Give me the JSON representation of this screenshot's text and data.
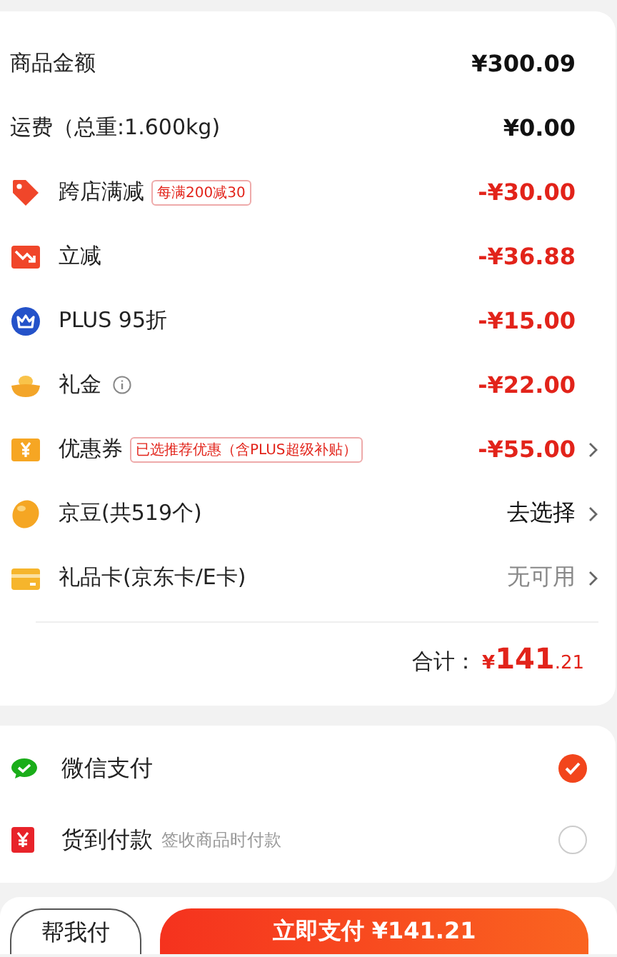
{
  "summary": {
    "rows": [
      {
        "kind": "plain",
        "label": "商品金额",
        "value": "¥300.09",
        "highlighted": false,
        "disabled": false,
        "chevron": false
      },
      {
        "kind": "plain",
        "label": "运费（总重:1.600kg)",
        "value": "¥0.00",
        "highlighted": false,
        "disabled": false,
        "chevron": false
      },
      {
        "kind": "tag",
        "label": "跨店满减",
        "badge": "每满200减30",
        "value": "-¥30.00",
        "highlighted": true,
        "disabled": false,
        "chevron": false
      },
      {
        "kind": "drop",
        "label": "立减",
        "value": "-¥36.88",
        "highlighted": true,
        "disabled": false,
        "chevron": false
      },
      {
        "kind": "crown",
        "label": "PLUS 95折",
        "value": "-¥15.00",
        "highlighted": true,
        "disabled": false,
        "chevron": false
      },
      {
        "kind": "ingot",
        "label": "礼金",
        "info": true,
        "value": "-¥22.00",
        "highlighted": true,
        "disabled": false,
        "chevron": false
      },
      {
        "kind": "coupon",
        "label": "优惠券",
        "badge": "已选推荐优惠（含PLUS超级补贴）",
        "value": "-¥55.00",
        "highlighted": true,
        "disabled": false,
        "chevron": true
      },
      {
        "kind": "bean",
        "label": "京豆(共519个)",
        "value": "去选择",
        "highlighted": false,
        "disabled": false,
        "chevron": true
      },
      {
        "kind": "card",
        "label": "礼品卡(京东卡/E卡)",
        "value": "无可用",
        "highlighted": false,
        "disabled": true,
        "chevron": true
      }
    ],
    "total": {
      "label": "合计：",
      "currency": "¥",
      "integer": "141",
      "decimal": ".21"
    }
  },
  "payment_methods": [
    {
      "kind": "wechat",
      "label": "微信支付",
      "selected": true
    },
    {
      "kind": "cash",
      "label": "货到付款",
      "note": "签收商品时付款",
      "selected": false
    }
  ],
  "buttons": [
    {
      "kind": "outline",
      "label": "帮我付"
    },
    {
      "kind": "primary",
      "label": "立即支付 ¥141.21"
    }
  ]
}
